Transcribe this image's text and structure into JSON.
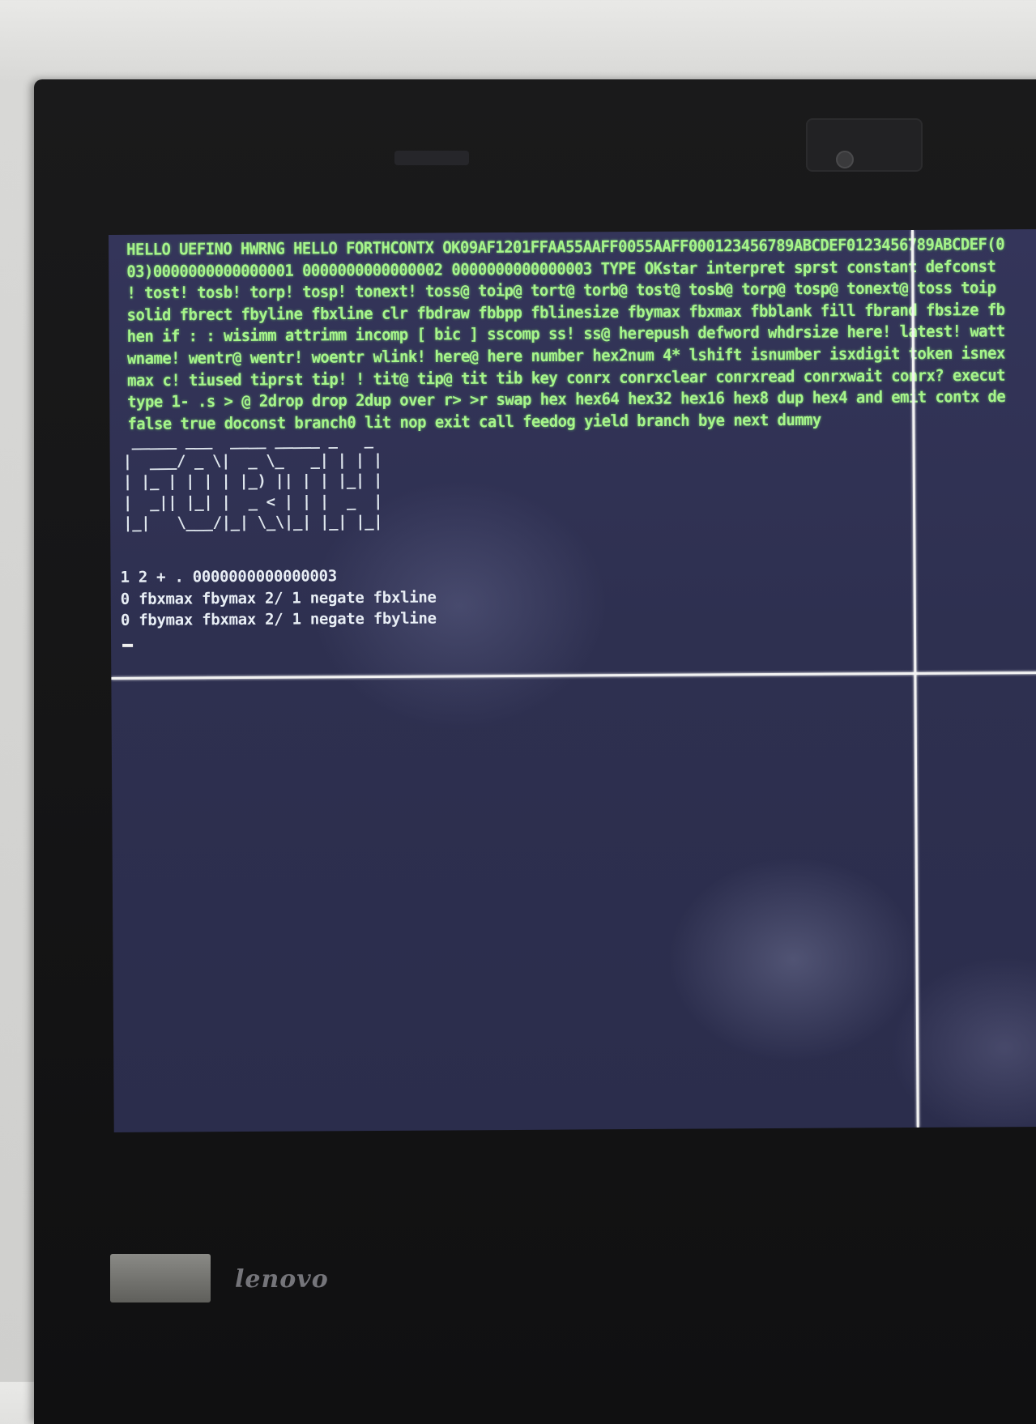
{
  "screen": {
    "output_lines": [
      "HELLO UEFINO HWRNG HELLO FORTHCONTX OK09AF1201FFAA55AAFF0055AAFF000123456789ABCDEF0123456789ABCDEF(0",
      "03)0000000000000001 0000000000000002 0000000000000003 TYPE OKstar interpret sprst constant defconst",
      "! tost! tosb! torp! tosp! tonext! toss@ toip@ tort@ torb@ tost@ tosb@ torp@ tosp@ tonext@ toss toip",
      "solid fbrect fbyline fbxline clr fbdraw fbbpp fblinesize fbymax fbxmax fbblank fill fbrand fbsize fb",
      "hen if : : wisimm attrimm incomp [ bic ] sscomp ss! ss@ herepush defword whdrsize here! latest! watt",
      "wname! wentr@ wentr! woentr wlink! here@ here number hex2num 4* lshift isnumber isxdigit token isnex",
      "max c! tiused tiprst tip! ! tit@ tip@ tit tib key conrx conrxclear conrxread conrxwait conrx? execut",
      "type 1- .s > @ 2drop drop 2dup over r> >r swap hex hex64 hex32 hex16 hex8 dup hex4 and emit contx de",
      "false true doconst branch0 lit nop exit call feedog yield branch bye next dummy"
    ],
    "banner_lines": [
      " _____ ___  ____ _____ _   _",
      "|  ___/ _ \\|  _ \\_   _| | | |",
      "| |_ | | | | |_) || | | |_| |",
      "|  _|| |_| |  _ < | | |  _  |",
      "|_|   \\___/|_| \\_\\|_| |_| |_|"
    ],
    "session_lines": [
      "1 2 + . 0000000000000003",
      "0 fbxmax fbymax 2/ 1 negate fbxline",
      "0 fbymax fbxmax 2/ 1 negate fbyline"
    ]
  },
  "bezel": {
    "brand": "lenovo"
  }
}
